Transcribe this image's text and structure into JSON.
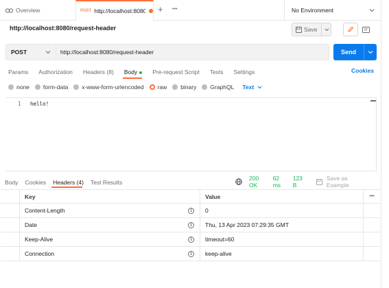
{
  "tabs": {
    "overview_label": "Overview",
    "active": {
      "method": "POST",
      "url": "http://localhost:8080/r"
    },
    "new_tab": "+",
    "more": "•••",
    "environment": "No Environment"
  },
  "request": {
    "title": "http://localhost:8080/request-header",
    "save_label": "Save",
    "method": "POST",
    "url": "http://localhost:8080/request-header",
    "send_label": "Send"
  },
  "request_tabs": [
    {
      "label": "Params"
    },
    {
      "label": "Authorization"
    },
    {
      "label": "Headers (8)"
    },
    {
      "label": "Body"
    },
    {
      "label": "Pre-request Script"
    },
    {
      "label": "Tests"
    },
    {
      "label": "Settings"
    }
  ],
  "cookies_link": "Cookies",
  "body_modes": {
    "none": "none",
    "form_data": "form-data",
    "urlencoded": "x-www-form-urlencoded",
    "raw": "raw",
    "binary": "binary",
    "graphql": "GraphQL",
    "text_type": "Text",
    "selected": "raw"
  },
  "editor": {
    "line_number": "1",
    "content": "hello!"
  },
  "response": {
    "tabs": [
      {
        "label": "Body"
      },
      {
        "label": "Cookies"
      },
      {
        "label": "Headers (4)"
      },
      {
        "label": "Test Results"
      }
    ],
    "status": "200 OK",
    "time": "62 ms",
    "size": "123 B",
    "save_example": "Save as Example",
    "more": "•••",
    "headers_table": {
      "columns": [
        "Key",
        "Value"
      ],
      "rows": [
        {
          "key": "Content-Length",
          "value": "0"
        },
        {
          "key": "Date",
          "value": "Thu, 13 Apr 2023 07:29:35 GMT"
        },
        {
          "key": "Keep-Alive",
          "value": "timeout=60"
        },
        {
          "key": "Connection",
          "value": "keep-alive"
        }
      ]
    }
  },
  "colors": {
    "accent": "#ff6c37",
    "primary": "#097bed",
    "success": "#0cbb52"
  }
}
